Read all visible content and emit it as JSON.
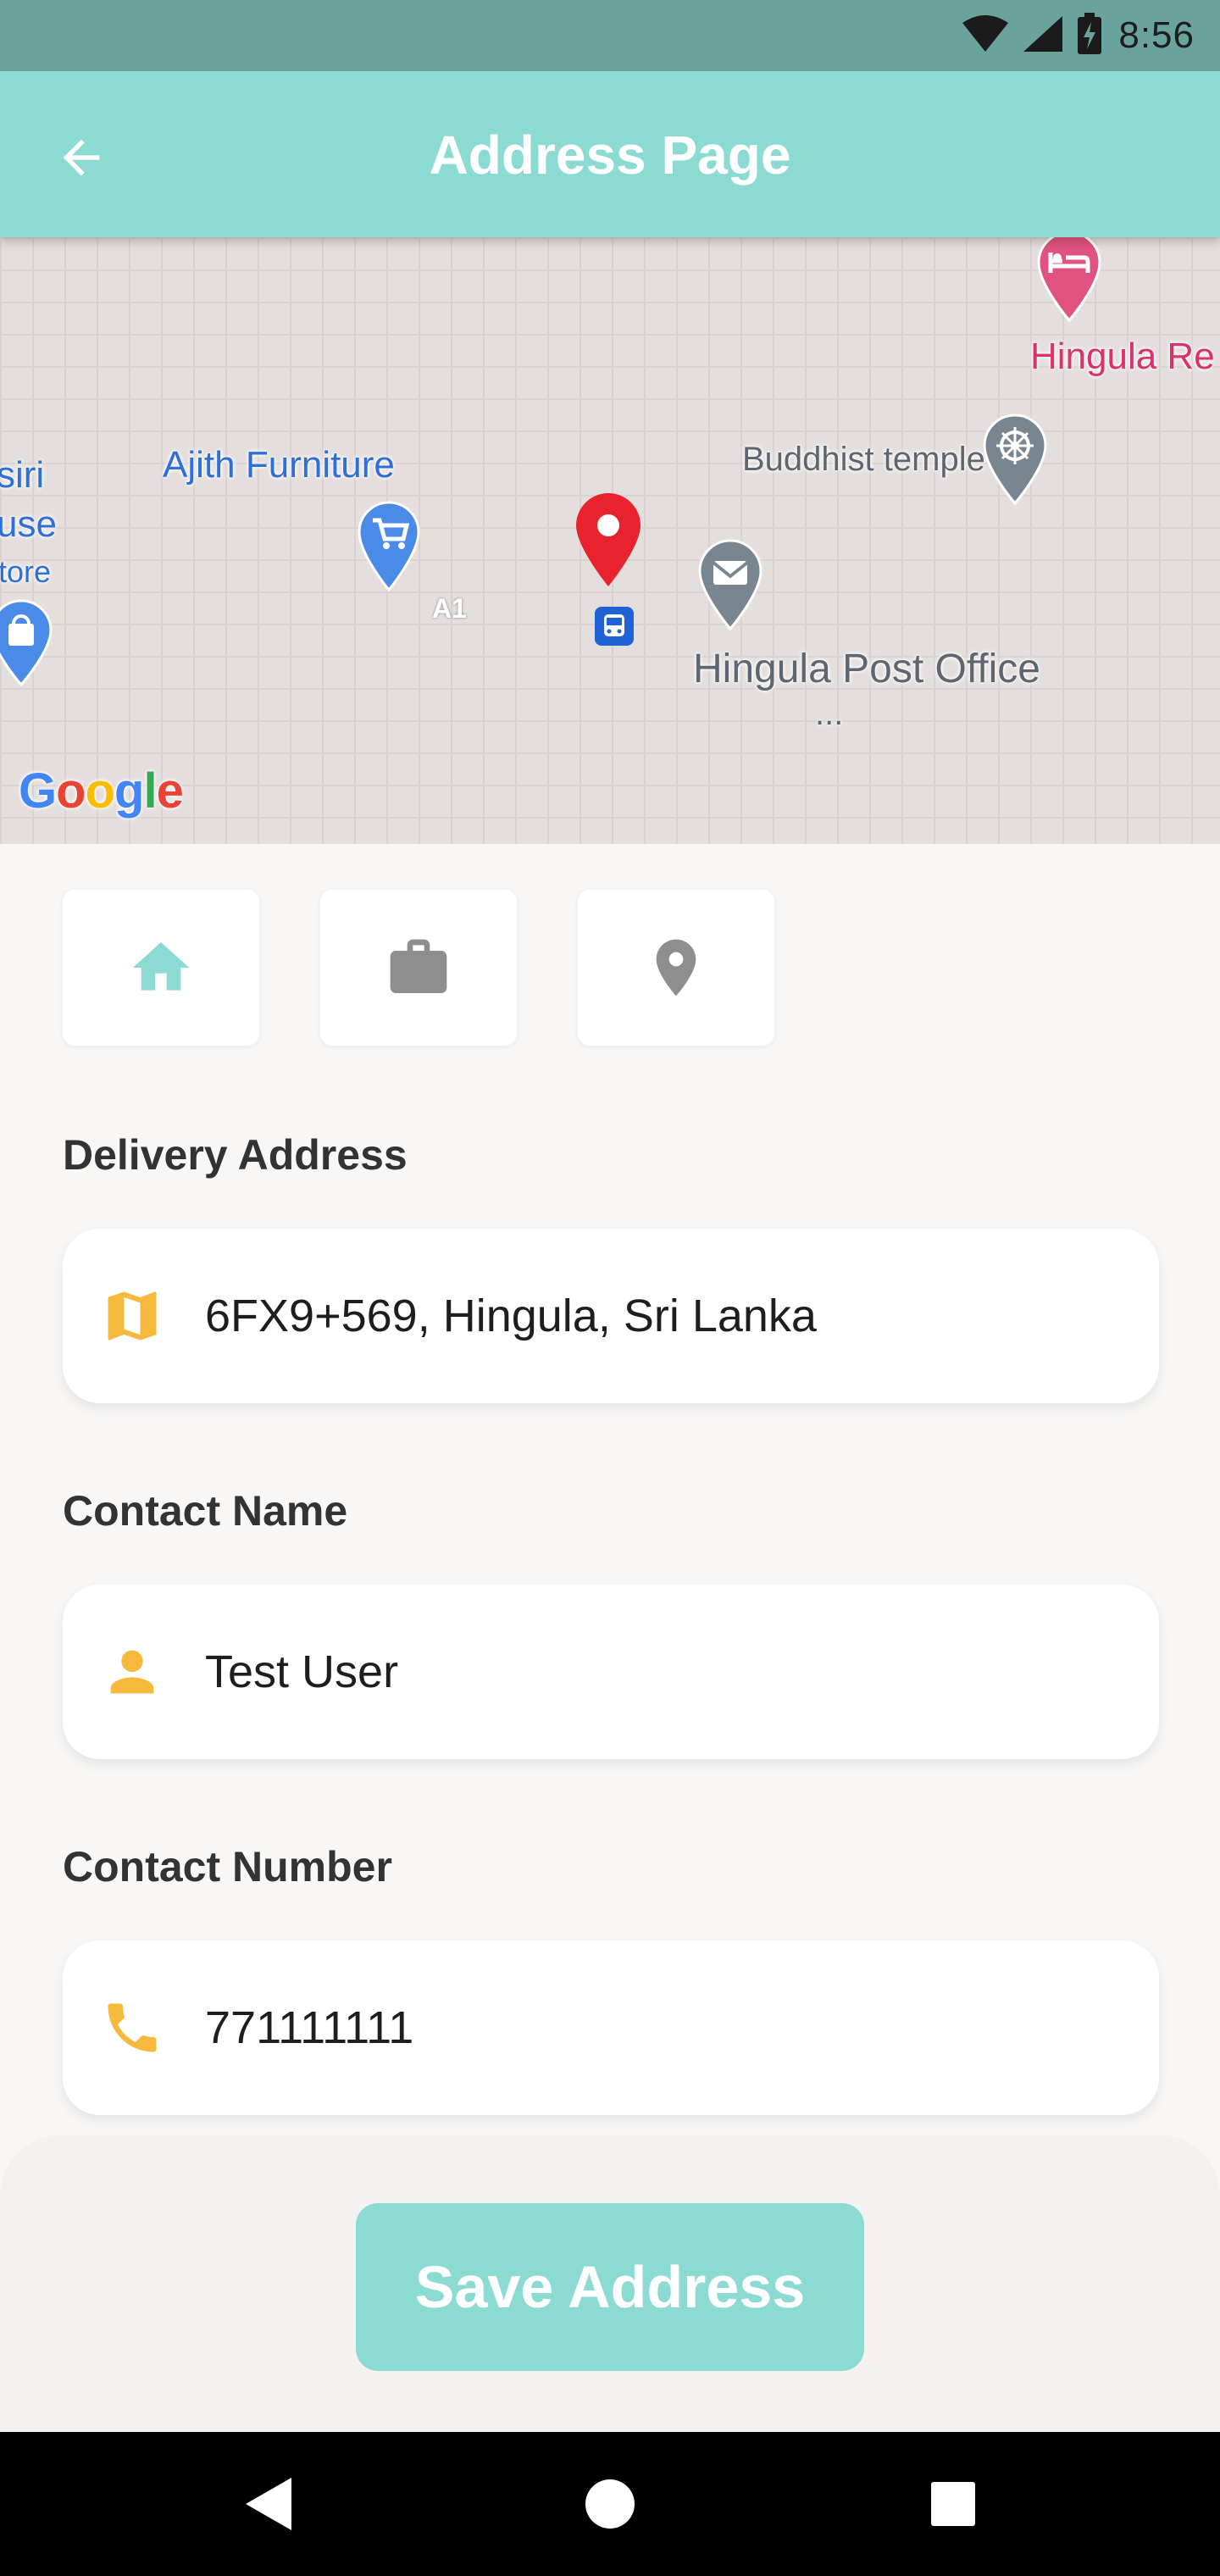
{
  "status_bar": {
    "time": "8:56",
    "icons": [
      "wifi-icon",
      "signal-icon",
      "battery-icon"
    ]
  },
  "app_bar": {
    "title": "Address Page",
    "back_icon": "arrow-left-icon"
  },
  "map": {
    "labels": {
      "ajith": "Ajith Furniture",
      "buddhist": "Buddhist temple",
      "post": "Hingula Post Office",
      "post_more": "...",
      "hingula_re": "Hingula Re",
      "siri": "siri",
      "use": "use",
      "tore": "tore",
      "a1": "A1"
    },
    "google": [
      "G",
      "o",
      "o",
      "g",
      "l",
      "e"
    ],
    "colors": {
      "selected_pin": "#e8232d",
      "poi_blue": "#4a8be8",
      "poi_gray": "#79868f",
      "poi_pink": "#e0527f"
    }
  },
  "address_types": [
    {
      "name": "home",
      "icon": "home-icon",
      "selected": true
    },
    {
      "name": "work",
      "icon": "briefcase-icon",
      "selected": false
    },
    {
      "name": "other",
      "icon": "location-pin-icon",
      "selected": false
    }
  ],
  "form": {
    "delivery_label": "Delivery Address",
    "delivery_value": "6FX9+569, Hingula, Sri Lanka",
    "contact_name_label": "Contact Name",
    "contact_name_value": "Test User",
    "contact_number_label": "Contact Number",
    "contact_number_value": "771111111"
  },
  "save_button": {
    "label": "Save Address"
  },
  "colors": {
    "primary": "#8cdbd2",
    "status_bar": "#6aa39c",
    "field_icon": "#f6b93b",
    "icon_gray": "#8e8e8e"
  }
}
